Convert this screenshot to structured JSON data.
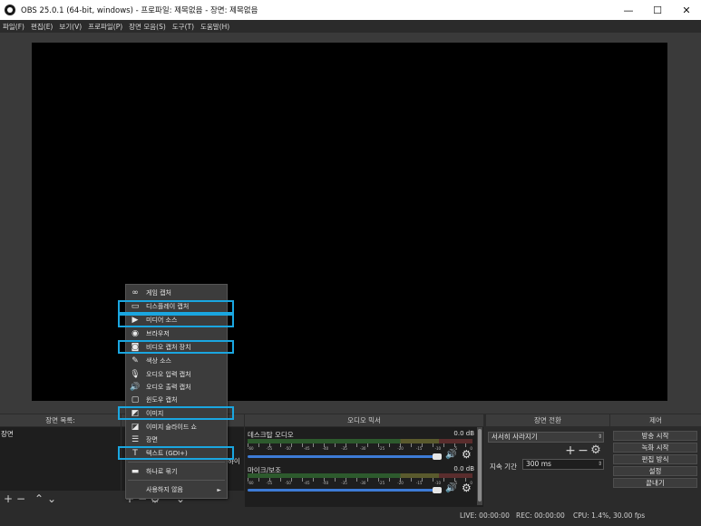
{
  "window": {
    "title": "OBS 25.0.1 (64-bit, windows) - 프로파일: 제목없음 - 장면: 제목없음",
    "controls": [
      "—",
      "☐",
      "✕"
    ]
  },
  "menubar": [
    "파일(F)",
    "편집(E)",
    "보기(V)",
    "프로파일(P)",
    "장면 모음(S)",
    "도구(T)",
    "도움말(H)"
  ],
  "docks": {
    "scenes": {
      "title": "장면 목록:",
      "items": [
        "장면"
      ]
    },
    "mixer": {
      "title": "오디오 믹서",
      "tracks": [
        {
          "name": "데스크탑 오디오",
          "db": "0.0 dB"
        },
        {
          "name": "마이크/보조",
          "db": "0.0 dB"
        }
      ],
      "meter_labels": [
        "-60",
        "-55",
        "-50",
        "-45",
        "-40",
        "-35",
        "-30",
        "-25",
        "-20",
        "-15",
        "-10",
        "-5",
        "0"
      ]
    },
    "transitions": {
      "title": "장면 전환",
      "selected": "서서히 사라지기",
      "duration_label": "지속 기간",
      "duration_value": "300 ms"
    },
    "controls": {
      "title": "제어",
      "buttons": [
        "방송 시작",
        "녹화 시작",
        "편집 방식",
        "설정",
        "끝내기"
      ]
    }
  },
  "context_menu": {
    "items": [
      {
        "icon": "∞",
        "label": "게임 캡처"
      },
      {
        "icon": "▭",
        "label": "디스플레이 캡처"
      },
      {
        "icon": "▶",
        "label": "미디어 소스"
      },
      {
        "icon": "◉",
        "label": "브라우저"
      },
      {
        "icon": "◙",
        "label": "비디오 캡처 장치"
      },
      {
        "icon": "✎",
        "label": "색상 소스"
      },
      {
        "icon": "🎙",
        "label": "오디오 입력 캡처"
      },
      {
        "icon": "🔊",
        "label": "오디오 출력 캡처"
      },
      {
        "icon": "▢",
        "label": "윈도우 캡처"
      },
      {
        "icon": "◩",
        "label": "이미지"
      },
      {
        "icon": "◪",
        "label": "이미지 슬라이드 쇼"
      },
      {
        "icon": "☰",
        "label": "장면"
      },
      {
        "icon": "T",
        "label": "텍스트 (GDI+)"
      }
    ],
    "group": {
      "icon": "▬",
      "label": "하나로 묶기"
    },
    "deprecated": {
      "label": "사용하지 않음"
    }
  },
  "partial_text": "하이",
  "status": {
    "live": "LIVE: 00:00:00",
    "rec": "REC: 00:00:00",
    "cpu": "CPU: 1.4%, 30.00 fps"
  },
  "colors": {
    "highlight": "#1aa6e0",
    "fader": "#3d7bd6"
  }
}
